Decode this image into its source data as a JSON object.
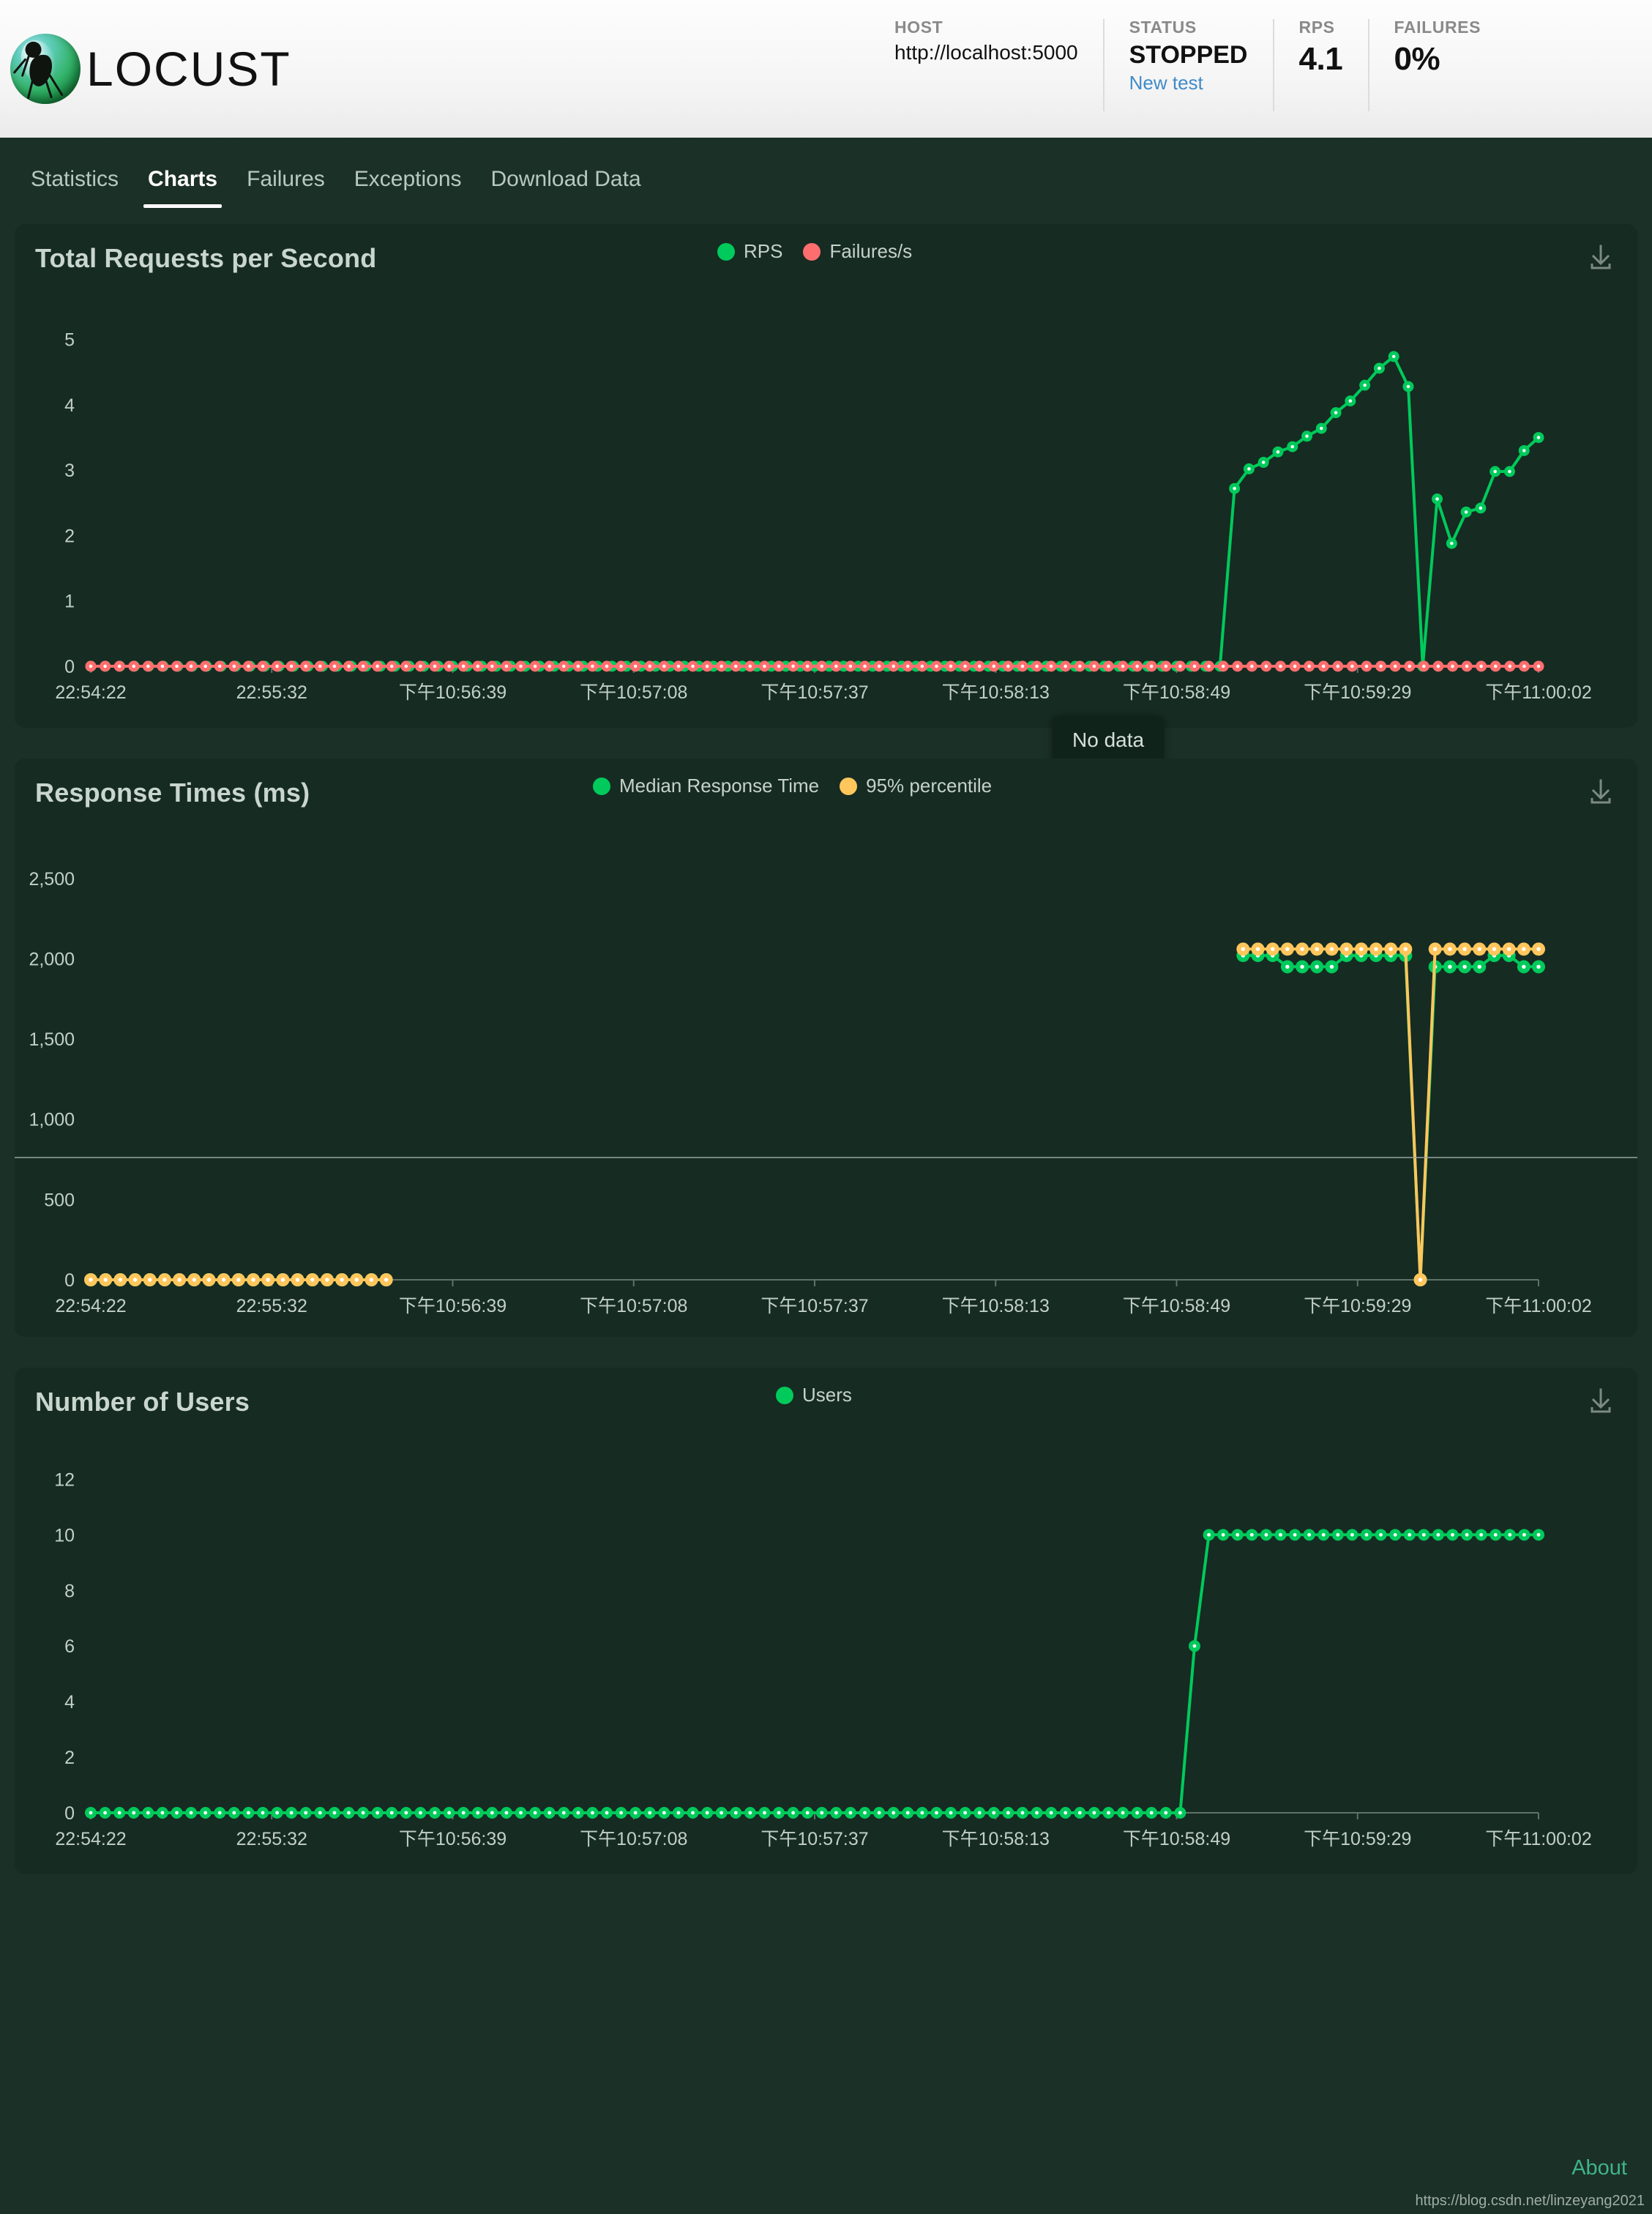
{
  "app": {
    "logo_text": "LOCUST",
    "logo_icon": "locust-logo-icon"
  },
  "header": {
    "stats": [
      {
        "key": "HOST",
        "value": "http://localhost:5000",
        "style": "plain"
      },
      {
        "key": "STATUS",
        "value": "STOPPED",
        "style": "bold",
        "link": "New test"
      },
      {
        "key": "RPS",
        "value": "4.1",
        "style": "big"
      },
      {
        "key": "FAILURES",
        "value": "0%",
        "style": "big"
      }
    ]
  },
  "nav": {
    "items": [
      {
        "label": "Statistics",
        "active": false
      },
      {
        "label": "Charts",
        "active": true
      },
      {
        "label": "Failures",
        "active": false
      },
      {
        "label": "Exceptions",
        "active": false
      },
      {
        "label": "Download Data",
        "active": false
      }
    ]
  },
  "tooltip": {
    "text": "No data"
  },
  "download_icon_name": "download-icon",
  "footer": {
    "about_label": "About",
    "watermark": "https://blog.csdn.net/linzeyang2021"
  },
  "colors": {
    "rps_green": "#00ca5b",
    "failures_red": "#ff6e6e",
    "percentile_amber": "#ffc65c",
    "page_bg": "#1b3027",
    "card_bg": "#162b22",
    "accent_link": "#3f8bc8",
    "about_link": "#3fb488"
  },
  "chart_data": [
    {
      "type": "line",
      "title": "Total Requests per Second",
      "xlabel": "",
      "ylabel": "",
      "ylim": [
        0,
        5.4
      ],
      "yticks": [
        0,
        1,
        2,
        3,
        4,
        5
      ],
      "ytick_labels": [
        "0",
        "1",
        "2",
        "3",
        "4",
        "5"
      ],
      "xtick_labels": [
        "22:54:22",
        "22:55:32",
        "下午10:56:39",
        "下午10:57:08",
        "下午10:57:37",
        "下午10:58:13",
        "下午10:58:49",
        "下午10:59:29",
        "下午11:00:02"
      ],
      "grid": false,
      "legend_position": "top-center",
      "series": [
        {
          "name": "RPS",
          "color": "#00ca5b",
          "values": [
            0,
            0,
            0,
            0,
            0,
            0,
            0,
            0,
            0,
            0,
            0,
            0,
            0,
            0,
            0,
            0,
            0,
            0,
            0,
            0,
            0,
            0,
            0,
            0,
            0,
            0,
            0,
            0,
            0,
            0,
            0,
            0,
            0,
            0,
            0,
            0,
            0,
            0,
            0,
            0,
            0,
            0,
            0,
            0,
            0,
            0,
            0,
            0,
            0,
            0,
            0,
            0,
            0,
            0,
            0,
            0,
            0,
            0,
            0,
            0,
            0,
            0,
            0,
            0,
            0,
            0,
            0,
            0,
            0,
            0,
            0,
            0,
            0,
            0,
            0,
            0,
            0,
            0,
            0,
            2.72,
            3.02,
            3.12,
            3.28,
            3.36,
            3.52,
            3.64,
            3.88,
            4.06,
            4.3,
            4.56,
            4.74,
            4.28,
            0,
            2.56,
            1.88,
            2.36,
            2.42,
            2.98,
            2.98,
            3.3,
            3.5
          ]
        },
        {
          "name": "Failures/s",
          "color": "#ff6e6e",
          "values": [
            0,
            0,
            0,
            0,
            0,
            0,
            0,
            0,
            0,
            0,
            0,
            0,
            0,
            0,
            0,
            0,
            0,
            0,
            0,
            0,
            0,
            0,
            0,
            0,
            0,
            0,
            0,
            0,
            0,
            0,
            0,
            0,
            0,
            0,
            0,
            0,
            0,
            0,
            0,
            0,
            0,
            0,
            0,
            0,
            0,
            0,
            0,
            0,
            0,
            0,
            0,
            0,
            0,
            0,
            0,
            0,
            0,
            0,
            0,
            0,
            0,
            0,
            0,
            0,
            0,
            0,
            0,
            0,
            0,
            0,
            0,
            0,
            0,
            0,
            0,
            0,
            0,
            0,
            0,
            0,
            0,
            0,
            0,
            0,
            0,
            0,
            0,
            0,
            0,
            0,
            0,
            0,
            0,
            0,
            0,
            0,
            0,
            0,
            0,
            0,
            0,
            0
          ]
        }
      ],
      "annotation": "No data"
    },
    {
      "type": "line",
      "title": "Response Times (ms)",
      "xlabel": "",
      "ylabel": "",
      "ylim": [
        0,
        2700
      ],
      "yticks": [
        0,
        500,
        1000,
        1500,
        2000,
        2500
      ],
      "ytick_labels": [
        "0",
        "500",
        "1,000",
        "1,500",
        "2,000",
        "2,500"
      ],
      "xtick_labels": [
        "22:54:22",
        "22:55:32",
        "下午10:56:39",
        "下午10:57:08",
        "下午10:57:37",
        "下午10:58:13",
        "下午10:58:49",
        "下午10:59:29",
        "下午11:00:02"
      ],
      "grid": false,
      "legend_position": "top-center",
      "series": [
        {
          "name": "Median Response Time",
          "color": "#00ca5b",
          "values": [
            0,
            0,
            0,
            0,
            0,
            0,
            0,
            0,
            0,
            0,
            0,
            0,
            0,
            0,
            0,
            0,
            0,
            0,
            0,
            0,
            0,
            null,
            null,
            null,
            null,
            null,
            null,
            null,
            null,
            null,
            null,
            null,
            null,
            null,
            null,
            null,
            null,
            null,
            null,
            null,
            null,
            null,
            null,
            null,
            null,
            null,
            null,
            null,
            null,
            null,
            null,
            null,
            null,
            null,
            null,
            null,
            null,
            null,
            null,
            null,
            null,
            null,
            null,
            null,
            null,
            null,
            null,
            null,
            null,
            null,
            null,
            null,
            null,
            null,
            null,
            null,
            null,
            null,
            2020,
            2020,
            2020,
            1950,
            1950,
            1950,
            1950,
            2020,
            2020,
            2020,
            2020,
            2020,
            0,
            1950,
            1950,
            1950,
            1950,
            2020,
            2020,
            1950,
            1950
          ]
        },
        {
          "name": "95% percentile",
          "color": "#ffc65c",
          "values": [
            0,
            0,
            0,
            0,
            0,
            0,
            0,
            0,
            0,
            0,
            0,
            0,
            0,
            0,
            0,
            0,
            0,
            0,
            0,
            0,
            0,
            null,
            null,
            null,
            null,
            null,
            null,
            null,
            null,
            null,
            null,
            null,
            null,
            null,
            null,
            null,
            null,
            null,
            null,
            null,
            null,
            null,
            null,
            null,
            null,
            null,
            null,
            null,
            null,
            null,
            null,
            null,
            null,
            null,
            null,
            null,
            null,
            null,
            null,
            null,
            null,
            null,
            null,
            null,
            null,
            null,
            null,
            null,
            null,
            null,
            null,
            null,
            null,
            null,
            null,
            null,
            null,
            null,
            2060,
            2060,
            2060,
            2060,
            2060,
            2060,
            2060,
            2060,
            2060,
            2060,
            2060,
            2060,
            0,
            2060,
            2060,
            2060,
            2060,
            2060,
            2060,
            2060,
            2060
          ]
        }
      ]
    },
    {
      "type": "line",
      "title": "Number of Users",
      "xlabel": "",
      "ylabel": "",
      "ylim": [
        0,
        12.8
      ],
      "yticks": [
        0,
        2,
        4,
        6,
        8,
        10,
        12
      ],
      "ytick_labels": [
        "0",
        "2",
        "4",
        "6",
        "8",
        "10",
        "12"
      ],
      "xtick_labels": [
        "22:54:22",
        "22:55:32",
        "下午10:56:39",
        "下午10:57:08",
        "下午10:57:37",
        "下午10:58:13",
        "下午10:58:49",
        "下午10:59:29",
        "下午11:00:02"
      ],
      "grid": false,
      "legend_position": "top-center",
      "series": [
        {
          "name": "Users",
          "color": "#00ca5b",
          "values": [
            0,
            0,
            0,
            0,
            0,
            0,
            0,
            0,
            0,
            0,
            0,
            0,
            0,
            0,
            0,
            0,
            0,
            0,
            0,
            0,
            0,
            0,
            0,
            0,
            0,
            0,
            0,
            0,
            0,
            0,
            0,
            0,
            0,
            0,
            0,
            0,
            0,
            0,
            0,
            0,
            0,
            0,
            0,
            0,
            0,
            0,
            0,
            0,
            0,
            0,
            0,
            0,
            0,
            0,
            0,
            0,
            0,
            0,
            0,
            0,
            0,
            0,
            0,
            0,
            0,
            0,
            0,
            0,
            0,
            0,
            0,
            0,
            0,
            0,
            0,
            0,
            0,
            6,
            10,
            10,
            10,
            10,
            10,
            10,
            10,
            10,
            10,
            10,
            10,
            10,
            10,
            10,
            10,
            10,
            10,
            10,
            10,
            10,
            10,
            10,
            10,
            10
          ]
        }
      ]
    }
  ]
}
